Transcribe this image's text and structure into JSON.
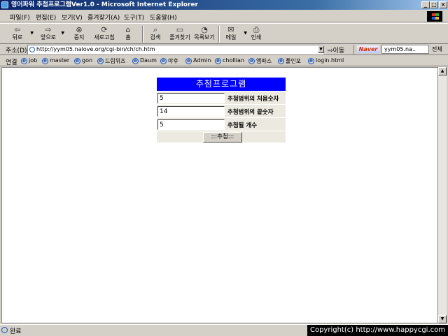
{
  "window": {
    "title": "영어파워 추첨프로그램Ver1.0 - Microsoft Internet Explorer",
    "min_label": "_",
    "max_label": "□",
    "close_label": "×"
  },
  "menu": [
    "파일(F)",
    "편집(E)",
    "보기(V)",
    "즐겨찾기(A)",
    "도구(T)",
    "도움말(H)"
  ],
  "toolbar": {
    "back": "뒤로",
    "forward": "앞으로",
    "stop": "중지",
    "refresh": "새로고침",
    "home": "홈",
    "search": "검색",
    "favorites": "즐겨찾기",
    "history": "목록보기",
    "mail": "메일",
    "print": "인쇄"
  },
  "address": {
    "label": "주소(D)",
    "url": "http://yym05.nalove.org/cgi-bin/ch/ch.htm",
    "go": "이동"
  },
  "naver": {
    "logo": "Naver",
    "query": "yym05.na..",
    "scope": "전체"
  },
  "links": {
    "label": "연결",
    "items": [
      "job",
      "master",
      "gon",
      "드림위즈",
      "Daum",
      "야후",
      "Admin",
      "chollian",
      "엠파스",
      "풀인포",
      "login.html"
    ]
  },
  "form": {
    "title": "추첨프로그램",
    "start_value": "5",
    "start_label": "추첨범위의 처음숫자",
    "end_value": "14",
    "end_label": "추첨범위의 끝숫자",
    "count_value": "5",
    "count_label": "추첨될 개수",
    "submit_label": ":::추첨:::"
  },
  "status": {
    "text": "완료",
    "copyright": "Copyright(c) http://www.happycgi.com"
  }
}
